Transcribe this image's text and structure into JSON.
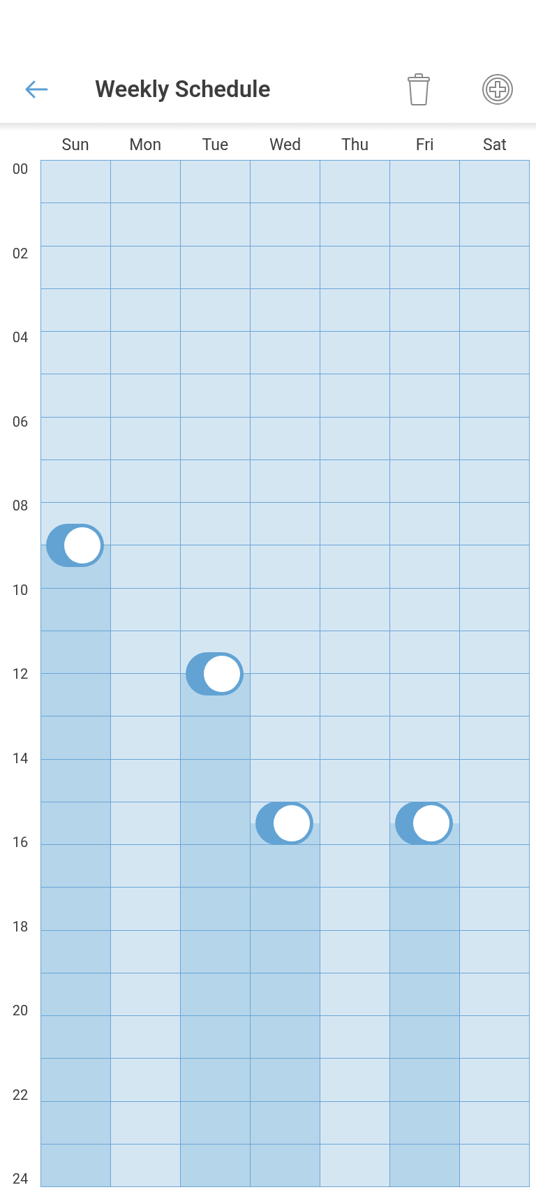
{
  "header": {
    "title": "Weekly Schedule"
  },
  "days": [
    {
      "label": "Sun",
      "level": 0.625,
      "on": true
    },
    {
      "label": "Mon",
      "level": 0
    },
    {
      "label": "Tue",
      "level": 0.5,
      "on": true
    },
    {
      "label": "Wed",
      "level": 0.354167,
      "on": true
    },
    {
      "label": "Thu",
      "level": 0
    },
    {
      "label": "Fri",
      "level": 0.354167,
      "on": true
    },
    {
      "label": "Sat",
      "level": 0
    }
  ],
  "hours": [
    "00",
    "02",
    "04",
    "06",
    "08",
    "10",
    "12",
    "14",
    "16",
    "18",
    "20",
    "22",
    "24"
  ]
}
